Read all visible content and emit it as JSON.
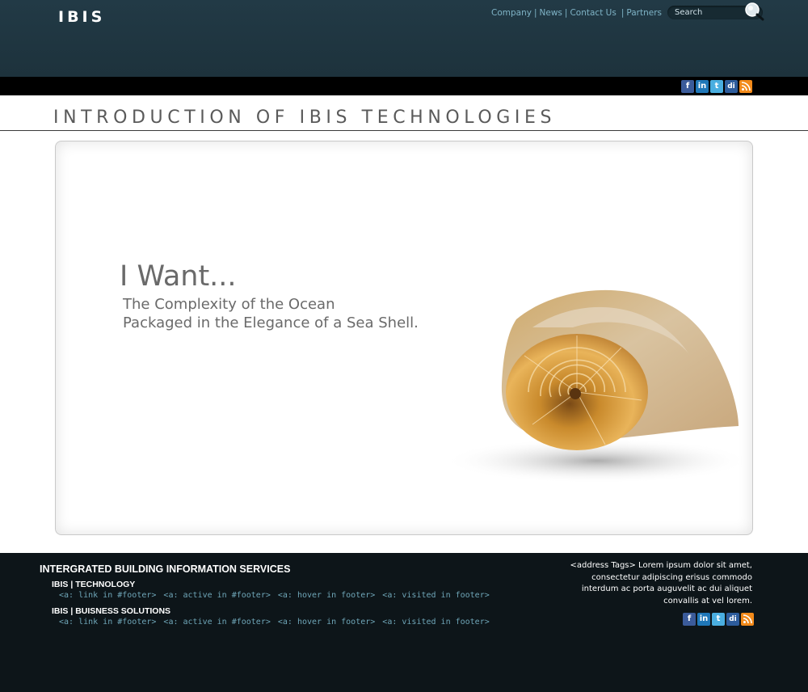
{
  "header": {
    "logo": "IBIS",
    "nav": [
      {
        "label": "Company"
      },
      {
        "label": "News"
      },
      {
        "label": "Contact Us"
      },
      {
        "label": "Partners"
      }
    ],
    "search_placeholder": "Search"
  },
  "social_icons": [
    "facebook-icon",
    "linkedin-icon",
    "twitter-icon",
    "delicious-icon",
    "rss-icon"
  ],
  "page": {
    "title": "INTRODUCTION OF IBIS TECHNOLOGIES"
  },
  "hero": {
    "headline": "I Want...",
    "tagline_line1": "The Complexity of the Ocean",
    "tagline_line2": "Packaged in the Elegance of a Sea Shell."
  },
  "footer": {
    "heading": "INTERGRATED BUILDING INFORMATION SERVICES",
    "groups": [
      {
        "title": "IBIS | TECHNOLOGY",
        "links": [
          "<a: link in #footer>",
          "<a: active in #footer>",
          "<a: hover in footer>",
          "<a: visited in footer>"
        ]
      },
      {
        "title": "IBIS | BUISNESS SOLUTIONS",
        "links": [
          "<a: link in #footer>",
          "<a: active in #footer>",
          "<a: hover in footer>",
          "<a: visited in footer>"
        ]
      }
    ],
    "address": "<address Tags>  Lorem ipsum dolor sit amet, consectetur adipiscing erisus commodo interdum ac porta auguvelit ac dui aliquet convallis at vel lorem."
  },
  "colors": {
    "header_bg": "#223a46",
    "nav_link": "#7fb3c6",
    "footer_bg": "#0d1519",
    "footer_link": "#6fa6b8"
  }
}
